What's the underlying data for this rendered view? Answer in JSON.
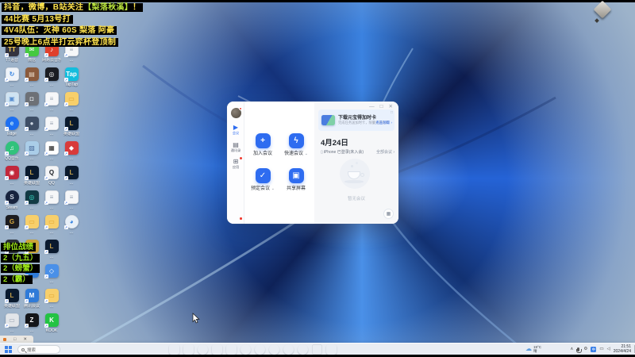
{
  "announcements": {
    "lines": [
      [
        {
          "t": "抖音，微博，B站关注",
          "c": "#ffe34d"
        },
        {
          "t": "【梨落秋溪】",
          "c": "#b8e23c"
        },
        {
          "t": "！",
          "c": "#ffe34d"
        }
      ],
      [
        {
          "t": "44比赛 5月13号打",
          "c": "#ffe34d"
        }
      ],
      [
        {
          "t": "4V4队伍：灭神 60S 梨落 阿豪",
          "c": "#ffe34d"
        }
      ],
      [
        {
          "t": "25号晚上6点半打云弈杯登顶制",
          "c": "#ffe34d"
        }
      ]
    ]
  },
  "ranked": {
    "color": "#9ce616",
    "lines": [
      "排位战绩",
      "2（九五）",
      "2（螃蟹）",
      "2（霸）"
    ]
  },
  "desktop_icons": [
    {
      "col": 0,
      "row": 0,
      "label": "TT语音",
      "bg": "#34333e",
      "glyph": "TT",
      "gc": "#ffd04d"
    },
    {
      "col": 1,
      "row": 0,
      "label": "微信",
      "bg": "#45c93f",
      "glyph": "✉",
      "gc": "#ffffff"
    },
    {
      "col": 2,
      "row": 0,
      "label": "网易云音乐",
      "bg": "#e0402c",
      "glyph": "♪",
      "gc": "#ffffff"
    },
    {
      "col": 3,
      "row": 0,
      "label": "…",
      "bg": "#f6f7f9",
      "glyph": "≡",
      "gc": "#9aa4b2",
      "border": true
    },
    {
      "col": 0,
      "row": 1,
      "label": "…",
      "bg": "#eef3f9",
      "glyph": "↻",
      "gc": "#2f7fe0",
      "border": true
    },
    {
      "col": 1,
      "row": 1,
      "label": "…",
      "bg": "#8a5a3c",
      "glyph": "▤",
      "gc": "#e9dac8"
    },
    {
      "col": 2,
      "row": 1,
      "label": "…",
      "bg": "#1a1c22",
      "glyph": "◎",
      "gc": "#ffffff"
    },
    {
      "col": 3,
      "row": 1,
      "label": "TapTap",
      "bg": "#14bddd",
      "glyph": "Tap",
      "gc": "#ffffff"
    },
    {
      "col": 0,
      "row": 2,
      "label": "…",
      "bg": "#cfe3f2",
      "glyph": "▣",
      "gc": "#5a8fd0",
      "border": true
    },
    {
      "col": 1,
      "row": 2,
      "label": "…",
      "bg": "#6d7076",
      "glyph": "◘",
      "gc": "#dfe3e8"
    },
    {
      "col": 2,
      "row": 2,
      "label": "…",
      "bg": "#f6f7f9",
      "glyph": "≡",
      "gc": "#9aa4b2",
      "border": true
    },
    {
      "col": 3,
      "row": 2,
      "label": "…",
      "bg": "#f7cf6b",
      "glyph": "▭",
      "gc": "#e0a42c"
    },
    {
      "col": 0,
      "row": 3,
      "label": "Edge",
      "bg": "#1d6ff2",
      "glyph": "e",
      "gc": "#bfe8f8",
      "round": true
    },
    {
      "col": 1,
      "row": 3,
      "label": "…",
      "bg": "#3e4e66",
      "glyph": "●",
      "gc": "#cdd6e2"
    },
    {
      "col": 2,
      "row": 3,
      "label": "…",
      "bg": "#f6f7f9",
      "glyph": "≡",
      "gc": "#9aa4b2",
      "border": true
    },
    {
      "col": 3,
      "row": 3,
      "label": "英雄联盟",
      "bg": "#0a1a2e",
      "glyph": "L",
      "gc": "#c8a24a"
    },
    {
      "col": 0,
      "row": 4,
      "label": "QQ音乐",
      "bg": "#31c27c",
      "glyph": "♫",
      "gc": "#ffffff",
      "round": true
    },
    {
      "col": 1,
      "row": 4,
      "label": "…",
      "bg": "#aacde8",
      "glyph": "▨",
      "gc": "#4a6a9a"
    },
    {
      "col": 2,
      "row": 4,
      "label": "…",
      "bg": "#ffffff",
      "glyph": "▦",
      "gc": "#222222",
      "border": true
    },
    {
      "col": 3,
      "row": 4,
      "label": "…",
      "bg": "#d83a3a",
      "glyph": "◆",
      "gc": "#ffffff"
    },
    {
      "col": 0,
      "row": 5,
      "label": "…",
      "bg": "#c2283c",
      "glyph": "◉",
      "gc": "#ffffff"
    },
    {
      "col": 1,
      "row": 5,
      "label": "英雄联盟",
      "bg": "#0a1a2e",
      "glyph": "L",
      "gc": "#c8a24a"
    },
    {
      "col": 2,
      "row": 5,
      "label": "QQ",
      "bg": "#f4f5f7",
      "glyph": "Q",
      "gc": "#1b1e24",
      "border": true
    },
    {
      "col": 3,
      "row": 5,
      "label": "…",
      "bg": "#0a1a2e",
      "glyph": "L",
      "gc": "#c8a24a"
    },
    {
      "col": 0,
      "row": 6,
      "label": "Steam",
      "bg": "#17233e",
      "glyph": "S",
      "gc": "#cfd8e4",
      "round": true
    },
    {
      "col": 1,
      "row": 6,
      "label": "…",
      "bg": "#123a44",
      "glyph": "◎",
      "gc": "#39e0c8"
    },
    {
      "col": 2,
      "row": 6,
      "label": "…",
      "bg": "#f6f7f9",
      "glyph": "≡",
      "gc": "#9aa4b2",
      "border": true
    },
    {
      "col": 3,
      "row": 6,
      "label": "…",
      "bg": "#f6f7f9",
      "glyph": "≡",
      "gc": "#9aa4b2",
      "border": true
    },
    {
      "col": 0,
      "row": 7,
      "label": "…",
      "bg": "#1c1c20",
      "glyph": "G",
      "gc": "#d8a83c"
    },
    {
      "col": 1,
      "row": 7,
      "label": "…",
      "bg": "#f7cf6b",
      "glyph": "▭",
      "gc": "#e0a42c"
    },
    {
      "col": 2,
      "row": 7,
      "label": "…",
      "bg": "#f7cf6b",
      "glyph": "▭",
      "gc": "#e0a42c"
    },
    {
      "col": 3,
      "row": 7,
      "label": "…",
      "bg": "#e8f0f8",
      "glyph": "◕",
      "gc": "#2f7fe0",
      "border": true,
      "round": true
    },
    {
      "col": 0,
      "row": 8,
      "label": "…",
      "bg": "#2a2d36",
      "glyph": "▾",
      "gc": "#9aa4b2"
    },
    {
      "col": 1,
      "row": 8,
      "label": "…",
      "bg": "#caa43a",
      "glyph": "T",
      "gc": "#4a3a10"
    },
    {
      "col": 2,
      "row": 8,
      "label": "…",
      "bg": "#0a1a2e",
      "glyph": "L",
      "gc": "#c8a24a"
    },
    {
      "col": 1,
      "row": 9,
      "label": "…",
      "bg": "#2f7bd8",
      "glyph": "M",
      "gc": "#ffffff"
    },
    {
      "col": 2,
      "row": 9,
      "label": "…",
      "bg": "#4a90e8",
      "glyph": "◇",
      "gc": "#ffffff"
    },
    {
      "col": 0,
      "row": 10,
      "label": "英雄联盟",
      "bg": "#0a1a2e",
      "glyph": "L",
      "gc": "#c8a24a"
    },
    {
      "col": 1,
      "row": 10,
      "label": "腾讯会议",
      "bg": "#2f7bd8",
      "glyph": "M",
      "gc": "#ffffff"
    },
    {
      "col": 2,
      "row": 10,
      "label": "…",
      "bg": "#f7cf6b",
      "glyph": "▭",
      "gc": "#e0a42c"
    },
    {
      "col": 0,
      "row": 11,
      "label": "…",
      "bg": "#e2e5e9",
      "glyph": "▭",
      "gc": "#9aa4b2",
      "border": true
    },
    {
      "col": 1,
      "row": 11,
      "label": "…",
      "bg": "#141519",
      "glyph": "Z",
      "gc": "#ffffff"
    },
    {
      "col": 2,
      "row": 11,
      "label": "KOOK",
      "bg": "#23c343",
      "glyph": "K",
      "gc": "#ffffff"
    }
  ],
  "meeting_window": {
    "controls": {
      "minimize": "—",
      "maximize": "□",
      "close": "✕"
    },
    "sidebar": {
      "nav": [
        {
          "label": "会议",
          "glyph": "▶",
          "active": true
        },
        {
          "label": "通讯录",
          "glyph": "▤"
        },
        {
          "label": "应用",
          "glyph": "⊞",
          "badge": true
        }
      ],
      "bottom": [
        {
          "glyph": "⇗",
          "badge": true,
          "name": "share"
        },
        {
          "glyph": "⚙",
          "badge": true,
          "name": "settings"
        },
        {
          "glyph": "☺",
          "name": "profile"
        }
      ]
    },
    "actions": [
      {
        "label": "加入会议",
        "glyph": "+"
      },
      {
        "label": "快速会议",
        "glyph": "ϟ",
        "dropdown": true
      },
      {
        "label": "预定会议",
        "glyph": "✓",
        "dropdown": true
      },
      {
        "label": "共享屏幕",
        "glyph": "▣"
      }
    ],
    "banner": {
      "title": "下载元宝得加时卡",
      "subtitle": "完成任务送加时卡，限量先到先得",
      "link": "点击领取 ›",
      "dismiss": "□"
    },
    "schedule": {
      "date": "4月24日",
      "device": "iPhone 已登录(未入会)",
      "device_icon": "▯",
      "all_link": "全部会议 ›",
      "empty": "暂无会议",
      "fab": "▦"
    }
  },
  "fragment_window": {
    "maximize": "□",
    "close": "✕"
  },
  "taskbar": {
    "search_placeholder": "搜索",
    "apps": [
      {
        "bg": "#7a2ee0",
        "glyph": "◗",
        "gc": "#ff7ad0"
      },
      {
        "bg": "#f7cf6b",
        "glyph": "▭",
        "gc": "#e0a42c"
      },
      {
        "bg": "#1d6ff2",
        "glyph": "e",
        "gc": "#bfe8f8",
        "round": true
      },
      {
        "bg": "#e8502a",
        "glyph": "▭",
        "gc": "#ffd9c8"
      },
      {
        "bg": "#1b1d22",
        "glyph": "◆",
        "gc": "#35e06a"
      },
      {
        "bg": "#e03428",
        "glyph": "●",
        "gc": "#ffffff",
        "round": true
      },
      {
        "bg": "#2f86e8",
        "glyph": "◕",
        "gc": "#d8ecff",
        "round": true
      },
      {
        "bg": "#1a2440",
        "glyph": "◑",
        "gc": "#8fb0e8",
        "round": true
      },
      {
        "bg": "#2fae4a",
        "glyph": "★",
        "gc": "#eaffea",
        "round": true
      },
      {
        "bg": "#f0a028",
        "glyph": "●",
        "gc": "#fff0d0",
        "round": true
      },
      {
        "bg": "#eef0f4",
        "glyph": "▤",
        "gc": "#9aa4b2",
        "border": true
      },
      {
        "bg": "#2f7bd8",
        "glyph": "M",
        "gc": "#ffffff"
      }
    ],
    "weather": {
      "temp": "19°C",
      "cond": "晴"
    },
    "tray": {
      "chevron": "∧",
      "ime": "中",
      "monitor": "▭",
      "speaker": "◁"
    },
    "clock": {
      "time": "21:51",
      "date": "2024/4/24"
    }
  }
}
